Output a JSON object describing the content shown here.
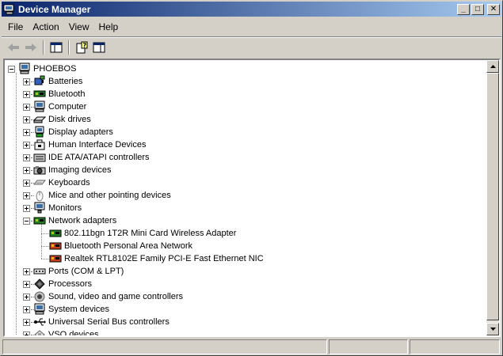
{
  "window": {
    "title": "Device Manager"
  },
  "title_controls": {
    "minimize": "_",
    "maximize": "□",
    "close": "✕"
  },
  "menu": [
    "File",
    "Action",
    "View",
    "Help"
  ],
  "toolbar": [
    "back-arrow-icon",
    "forward-arrow-icon",
    "console-tree-icon",
    "properties-help-icon",
    "show-hide-icon"
  ],
  "tree": {
    "root": "PHOEBOS",
    "categories": [
      {
        "label": "Batteries",
        "icon": "battery-icon",
        "expanded": false
      },
      {
        "label": "Bluetooth",
        "icon": "bluetooth-icon",
        "expanded": false
      },
      {
        "label": "Computer",
        "icon": "computer-icon",
        "expanded": false
      },
      {
        "label": "Disk drives",
        "icon": "disk-drive-icon",
        "expanded": false
      },
      {
        "label": "Display adapters",
        "icon": "display-adapter-icon",
        "expanded": false
      },
      {
        "label": "Human Interface Devices",
        "icon": "hid-icon",
        "expanded": false
      },
      {
        "label": "IDE ATA/ATAPI controllers",
        "icon": "ide-controller-icon",
        "expanded": false
      },
      {
        "label": "Imaging devices",
        "icon": "imaging-device-icon",
        "expanded": false
      },
      {
        "label": "Keyboards",
        "icon": "keyboard-icon",
        "expanded": false
      },
      {
        "label": "Mice and other pointing devices",
        "icon": "mouse-icon",
        "expanded": false
      },
      {
        "label": "Monitors",
        "icon": "monitor-icon",
        "expanded": false
      },
      {
        "label": "Network adapters",
        "icon": "network-adapter-icon",
        "expanded": true,
        "children": [
          "802.11bgn 1T2R Mini Card Wireless Adapter",
          "Bluetooth Personal Area Network",
          "Realtek RTL8102E Family PCI-E Fast Ethernet NIC"
        ]
      },
      {
        "label": "Ports (COM & LPT)",
        "icon": "port-icon",
        "expanded": false
      },
      {
        "label": "Processors",
        "icon": "processor-icon",
        "expanded": false
      },
      {
        "label": "Sound, video and game controllers",
        "icon": "sound-icon",
        "expanded": false
      },
      {
        "label": "System devices",
        "icon": "system-device-icon",
        "expanded": false
      },
      {
        "label": "Universal Serial Bus controllers",
        "icon": "usb-icon",
        "expanded": false
      },
      {
        "label": "VSO devices",
        "icon": "vso-device-icon",
        "expanded": false
      }
    ]
  },
  "colors": {
    "titlebar_start": "#0a246a",
    "titlebar_end": "#a6caf0",
    "chrome": "#d4d0c8"
  }
}
